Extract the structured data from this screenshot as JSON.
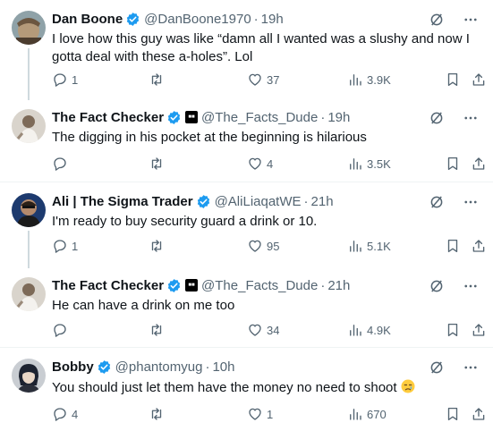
{
  "tweets": [
    {
      "name": "Dan Boone",
      "handle": "@DanBoone1970",
      "time": "19h",
      "text": "I love how this guy was like “damn all I wanted was a slushy and now I gotta deal with these a-holes”. Lol",
      "replies": "1",
      "retweets": "",
      "likes": "37",
      "views": "3.9K"
    },
    {
      "name": "The Fact Checker",
      "handle": "@The_Facts_Dude",
      "time": "19h",
      "text": "The digging in his pocket at the beginning is hilarious",
      "replies": "",
      "retweets": "",
      "likes": "4",
      "views": "3.5K"
    },
    {
      "name": "Ali | The Sigma Trader",
      "handle": "@AliLiaqatWE",
      "time": "21h",
      "text": "I'm ready to buy security guard a drink or 10.",
      "replies": "1",
      "retweets": "",
      "likes": "95",
      "views": "5.1K"
    },
    {
      "name": "The Fact Checker",
      "handle": "@The_Facts_Dude",
      "time": "21h",
      "text": "He can have a drink on me too",
      "replies": "",
      "retweets": "",
      "likes": "34",
      "views": "4.9K"
    },
    {
      "name": "Bobby",
      "handle": "@phantomyug",
      "time": "10h",
      "text": "You should just let them have the money no need to shoot",
      "replies": "4",
      "retweets": "",
      "likes": "1",
      "views": "670"
    }
  ],
  "icons": {
    "reply": "reply-icon",
    "retweet": "retweet-icon",
    "like": "heart-icon",
    "views": "views-chart-icon",
    "bookmark": "bookmark-icon",
    "share": "share-icon",
    "grok": "grok-icon",
    "more": "more-icon",
    "verified": "verified-badge-icon"
  },
  "colors": {
    "text": "#0f1419",
    "secondary": "#536471",
    "verified": "#1d9bf0",
    "divider": "#eff3f4",
    "thread_line": "#cfd9de"
  }
}
